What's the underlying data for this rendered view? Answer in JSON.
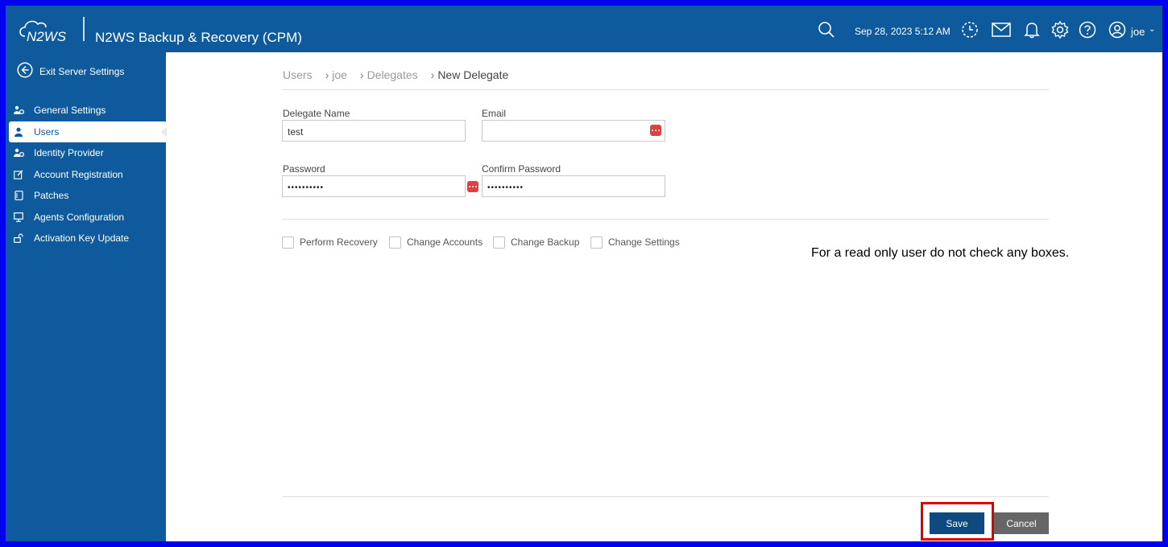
{
  "header": {
    "logo_text": "N2WS",
    "app_title": "N2WS Backup & Recovery (CPM)",
    "datetime": "Sep 28, 2023 5:12 AM",
    "user": "joe",
    "icons": [
      "search-icon",
      "recent-activity-icon",
      "mail-icon",
      "bell-icon",
      "gear-icon",
      "help-icon",
      "user-circle-icon",
      "chevron-down-icon"
    ]
  },
  "sidebar": {
    "exit_label": "Exit Server Settings",
    "items": [
      {
        "label": "General Settings",
        "icon": "users-gear-icon"
      },
      {
        "label": "Users",
        "icon": "user-icon",
        "active": true
      },
      {
        "label": "Identity Provider",
        "icon": "users-gear-icon"
      },
      {
        "label": "Account Registration",
        "icon": "edit-icon"
      },
      {
        "label": "Patches",
        "icon": "patch-icon"
      },
      {
        "label": "Agents Configuration",
        "icon": "monitor-icon"
      },
      {
        "label": "Activation Key Update",
        "icon": "unlock-icon"
      }
    ]
  },
  "breadcrumb": [
    "Users",
    "joe",
    "Delegates",
    "New Delegate"
  ],
  "form": {
    "delegate_name_label": "Delegate Name",
    "delegate_name_value": "test",
    "email_label": "Email",
    "email_value": "",
    "password_label": "Password",
    "password_value": "••••••••••",
    "confirm_password_label": "Confirm Password",
    "confirm_password_value": "••••••••••"
  },
  "permissions": [
    {
      "label": "Perform Recovery",
      "checked": false
    },
    {
      "label": "Change Accounts",
      "checked": false
    },
    {
      "label": "Change Backup",
      "checked": false
    },
    {
      "label": "Change Settings",
      "checked": false
    }
  ],
  "annotation": "For a read only user do not check any boxes.",
  "actions": {
    "save": "Save",
    "cancel": "Cancel"
  },
  "colors": {
    "brand": "#0e5a9c",
    "save": "#0e4a80",
    "cancel": "#666666",
    "highlight": "#e00000",
    "pw_manager": "#e04040"
  }
}
